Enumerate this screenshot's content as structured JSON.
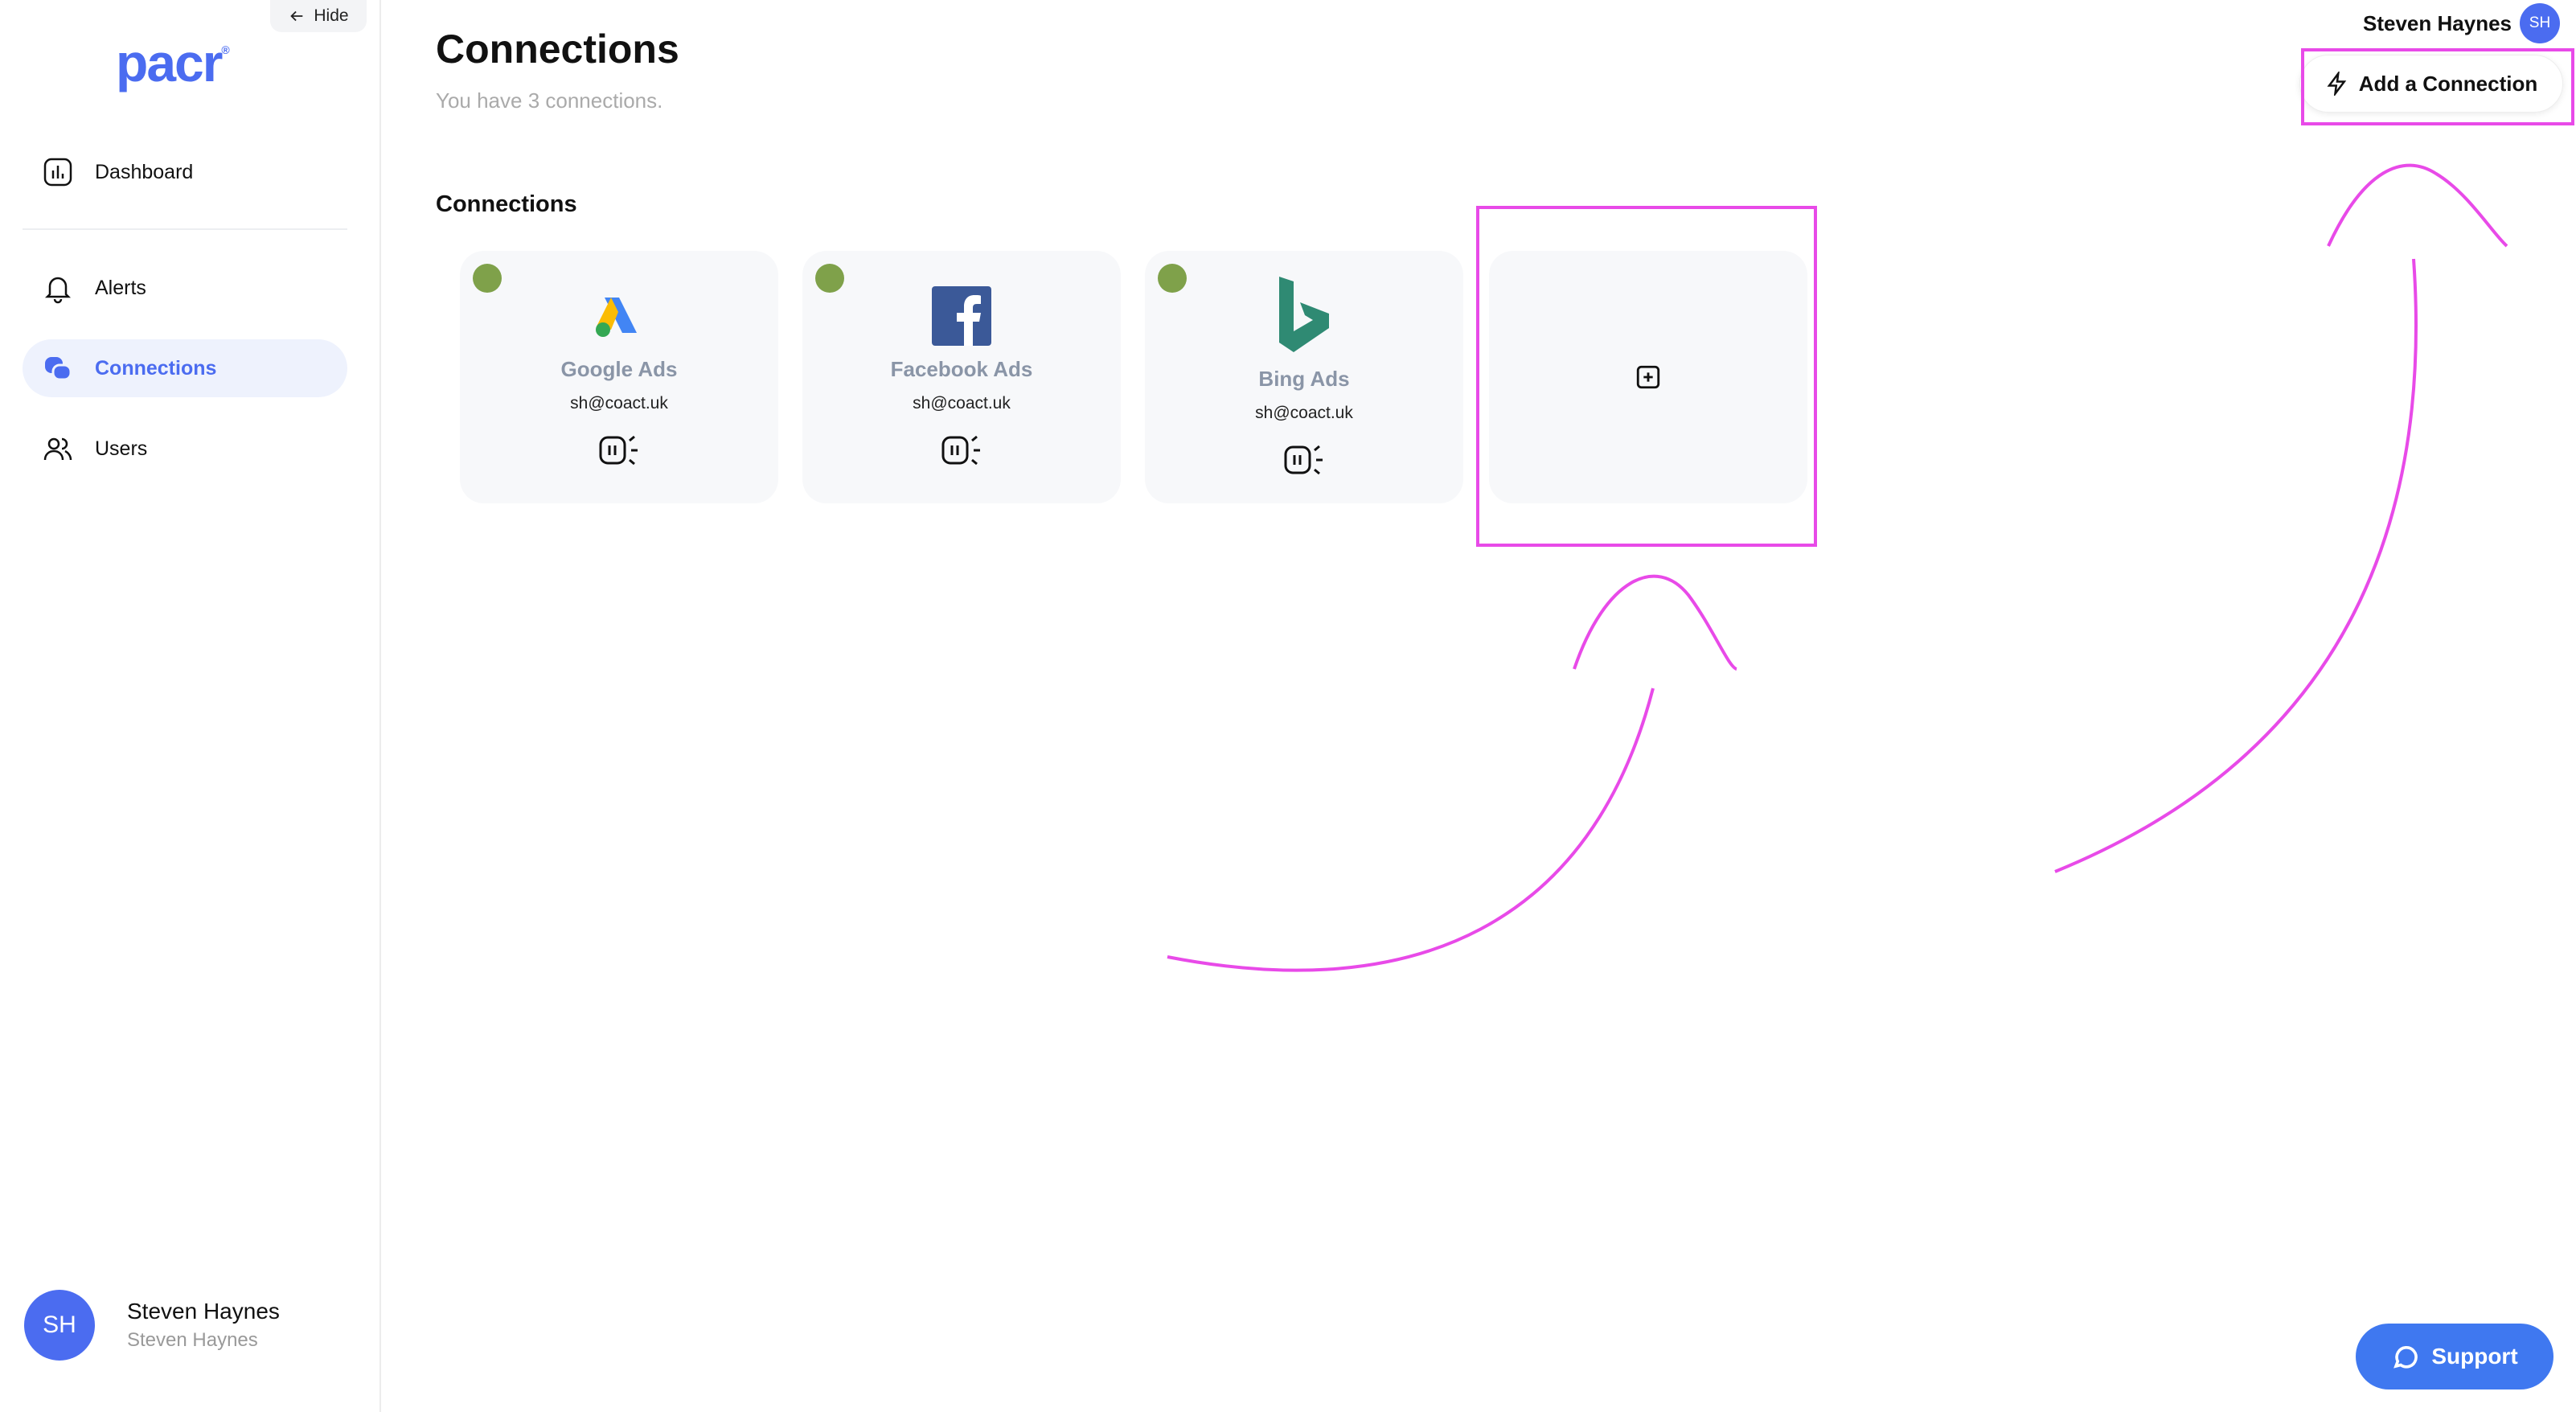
{
  "sidebar": {
    "logo": "pacr",
    "hide_label": "Hide",
    "items": [
      {
        "label": "Dashboard",
        "icon": "chart-icon"
      },
      {
        "label": "Alerts",
        "icon": "bell-icon"
      },
      {
        "label": "Connections",
        "icon": "connections-icon",
        "active": true
      },
      {
        "label": "Users",
        "icon": "users-icon"
      }
    ],
    "user": {
      "initials": "SH",
      "name": "Steven Haynes",
      "subtitle": "Steven Haynes"
    }
  },
  "header": {
    "title": "Connections",
    "subtitle": "You have 3 connections.",
    "user_name": "Steven Haynes",
    "user_initials": "SH",
    "add_button": "Add a Connection"
  },
  "connections": {
    "section_title": "Connections",
    "items": [
      {
        "name": "Google Ads",
        "email": "sh@coact.uk",
        "status": "connected",
        "icon": "google-ads-icon"
      },
      {
        "name": "Facebook Ads",
        "email": "sh@coact.uk",
        "status": "connected",
        "icon": "facebook-icon"
      },
      {
        "name": "Bing Ads",
        "email": "sh@coact.uk",
        "status": "connected",
        "icon": "bing-icon"
      }
    ]
  },
  "support": {
    "label": "Support"
  },
  "colors": {
    "accent": "#4b6cf0",
    "status_connected": "#7fa14a",
    "annotation": "#e84ae8",
    "support": "#3f78f0"
  }
}
